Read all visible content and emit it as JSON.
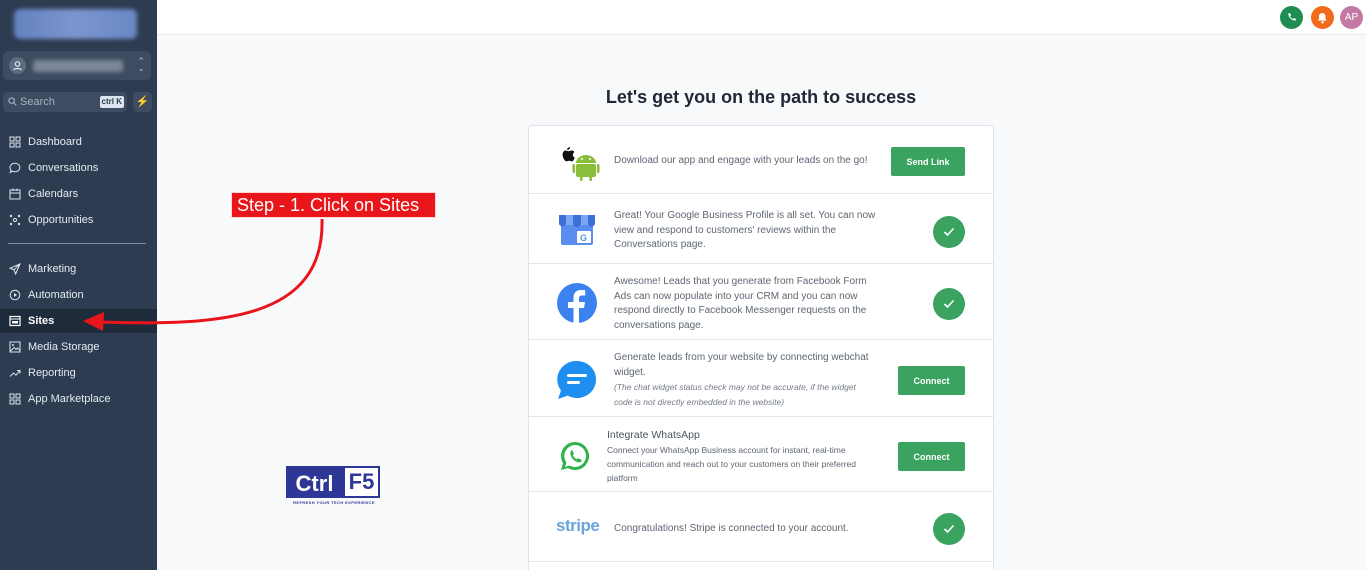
{
  "sidebar": {
    "search_placeholder": "Search",
    "search_shortcut": "ctrl K",
    "items": [
      {
        "label": "Dashboard",
        "icon": "dashboard-icon"
      },
      {
        "label": "Conversations",
        "icon": "chat-bubble-icon"
      },
      {
        "label": "Calendars",
        "icon": "calendar-icon"
      },
      {
        "label": "Opportunities",
        "icon": "opportunities-icon"
      },
      {
        "label": "Marketing",
        "icon": "send-icon"
      },
      {
        "label": "Automation",
        "icon": "automation-icon"
      },
      {
        "label": "Sites",
        "icon": "sites-icon",
        "active": true
      },
      {
        "label": "Media Storage",
        "icon": "image-icon"
      },
      {
        "label": "Reporting",
        "icon": "trend-icon"
      },
      {
        "label": "App Marketplace",
        "icon": "grid-icon"
      }
    ]
  },
  "topbar": {
    "avatar_initials": "AP"
  },
  "annotation": {
    "step_text": "Step - 1. Click on Sites"
  },
  "brand": {
    "ctrl": "Ctrl",
    "f5": "F5",
    "tagline": "REFRESH YOUR TECH EXPERIENCE"
  },
  "main": {
    "heading": "Let's get you on the path to success",
    "rows": [
      {
        "text": "Download our app and engage with your leads on the go!",
        "action": "Send Link"
      },
      {
        "text": "Great! Your Google Business Profile is all set. You can now view and respond to customers' reviews within the Conversations page.",
        "status": "done"
      },
      {
        "text": "Awesome! Leads that you generate from Facebook Form Ads can now populate into your CRM and you can now respond directly to Facebook Messenger requests on the conversations page.",
        "status": "done"
      },
      {
        "text": "Generate leads from your website by connecting webchat widget.",
        "note": "(The chat widget status check may not be accurate, if the widget code is not directly embedded in the website)",
        "action": "Connect"
      },
      {
        "title": "Integrate WhatsApp",
        "text": "Connect your WhatsApp Business account for instant, real-time communication and reach out to your customers on their preferred platform",
        "action": "Connect"
      },
      {
        "logo": "stripe",
        "text": "Congratulations! Stripe is connected to your account.",
        "status": "done"
      }
    ]
  },
  "colors": {
    "sidebar": "#2d3c51",
    "accent_green": "#3aa35f",
    "annotation_red": "#e8161b"
  }
}
